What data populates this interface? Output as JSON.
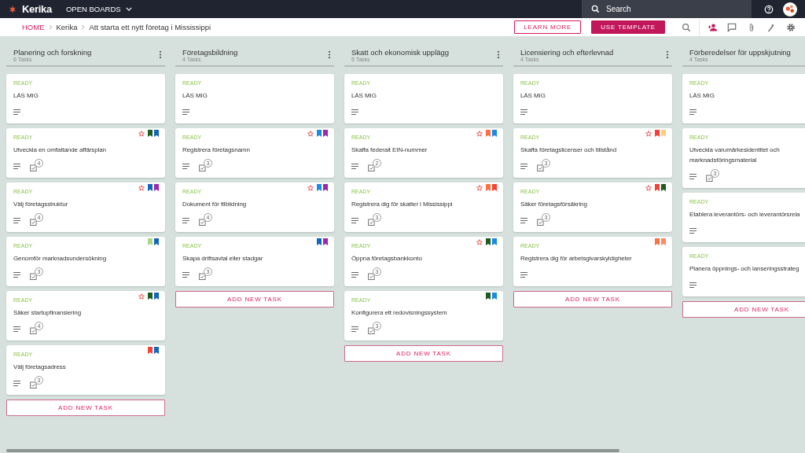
{
  "topbar": {
    "logo": "Kerika",
    "menu": "OPEN BOARDS",
    "search": {
      "placeholder": "Search"
    }
  },
  "breadcrumb": [
    "HOME",
    "Kerika",
    "Att starta ett nytt företag i Mississippi"
  ],
  "actions": [
    "LEARN MORE",
    "USE TEMPLATE"
  ],
  "columns": [
    {
      "title": "Planering och forskning",
      "count": "6 Tasks",
      "add": "ADD NEW TASK",
      "cards": [
        {
          "status": "READY",
          "title": "LÄS MIG",
          "starred": false
        },
        {
          "status": "READY",
          "title": "Utveckla en omfattande affärsplan",
          "starred": true,
          "tags": [
            {
              "color": "#1b5e20"
            },
            {
              "color": "#1565c0"
            }
          ],
          "checklist": "4"
        },
        {
          "status": "READY",
          "title": "Välj företagsstruktur",
          "starred": true,
          "tags": [
            {
              "color": "#1565c0"
            },
            {
              "color": "#9c27b0"
            }
          ],
          "checklist": "4"
        },
        {
          "status": "READY",
          "title": "Genomför marknadsundersökning",
          "starred": false,
          "tags": [
            {
              "color": "#aed581"
            },
            {
              "color": "#1565c0"
            }
          ],
          "checklist": "3"
        },
        {
          "status": "READY",
          "title": "Säker startupfinansiering",
          "starred": true,
          "tags": [
            {
              "color": "#1b5e20"
            },
            {
              "color": "#1565c0"
            }
          ],
          "checklist": "4"
        },
        {
          "status": "READY",
          "title": "Välj företagsadress",
          "starred": false,
          "tags": [
            {
              "color": "#f44336"
            },
            {
              "color": "#1565c0"
            }
          ],
          "checklist": "3"
        }
      ]
    },
    {
      "title": "Företagsbildning",
      "count": "4 Tasks",
      "add": "ADD NEW TASK",
      "cards": [
        {
          "status": "READY",
          "title": "LÄS MIG",
          "starred": false
        },
        {
          "status": "READY",
          "title": "Registrera företagsnamn",
          "starred": true,
          "tags": [
            {
              "color": "#1e88e5"
            },
            {
              "color": "#9c27b0"
            }
          ],
          "checklist": "3"
        },
        {
          "status": "READY",
          "title": "Dokument för filbildning",
          "starred": true,
          "tags": [
            {
              "color": "#1e88e5"
            },
            {
              "color": "#9c27b0"
            }
          ],
          "checklist": "4"
        },
        {
          "status": "READY",
          "title": "Skapa driftsavtal eller stadgar",
          "starred": false,
          "tags": [
            {
              "color": "#1565c0"
            },
            {
              "color": "#9c27b0"
            }
          ],
          "checklist": "3"
        }
      ]
    },
    {
      "title": "Skatt och ekonomisk upplägg",
      "count": "5 Tasks",
      "add": "ADD NEW TASK",
      "cards": [
        {
          "status": "READY",
          "title": "LÄS MIG",
          "starred": false
        },
        {
          "status": "READY",
          "title": "Skaffa federalt EIN-nummer",
          "starred": true,
          "tags": [
            {
              "color": "#ff7043"
            },
            {
              "color": "#1e88e5"
            }
          ],
          "checklist": "2"
        },
        {
          "status": "READY",
          "title": "Registrera dig för skatter i Mississippi",
          "starred": true,
          "tags": [
            {
              "color": "#ff7043"
            },
            {
              "color": "#f44336"
            }
          ],
          "checklist": "3"
        },
        {
          "status": "READY",
          "title": "Öppna företagsbankkonto",
          "starred": true,
          "tags": [
            {
              "color": "#1b5e20"
            },
            {
              "color": "#1e88e5"
            }
          ],
          "checklist": "3"
        },
        {
          "status": "READY",
          "title": "Konfigurera ett redovisningssystem",
          "starred": false,
          "tags": [
            {
              "color": "#1b5e20"
            },
            {
              "color": "#1e88e5"
            }
          ],
          "checklist": "3"
        }
      ]
    },
    {
      "title": "Licensiering och efterlevnad",
      "count": "4 Tasks",
      "add": "ADD NEW TASK",
      "cards": [
        {
          "status": "READY",
          "title": "LÄS MIG",
          "starred": false
        },
        {
          "status": "READY",
          "title": "Skaffa företagslicenser och tillstånd",
          "starred": true,
          "tags": [
            {
              "color": "#f44336"
            },
            {
              "color": "#ffcc80"
            }
          ],
          "checklist": "3"
        },
        {
          "status": "READY",
          "title": "Säker företagsförsäkring",
          "starred": true,
          "tags": [
            {
              "color": "#f44336"
            },
            {
              "color": "#1b5e20"
            }
          ],
          "checklist": "3"
        },
        {
          "status": "READY",
          "title": "Registrera dig för arbetsgivarskyldigheter",
          "starred": false,
          "tags": [
            {
              "color": "#ff7043"
            },
            {
              "color": "#ff8a65"
            }
          ]
        }
      ]
    },
    {
      "title": "Förberedelser för uppskjutning",
      "count": "4 Tasks",
      "add": "ADD NEW TASK",
      "cards": [
        {
          "status": "READY",
          "title": "LÄS MIG",
          "starred": false
        },
        {
          "status": "READY",
          "title": "Utveckla varumärkesidentitet och marknadsföringsmaterial",
          "starred": false,
          "checklist": "3"
        },
        {
          "status": "READY",
          "title": "Etablera leverantörs- och leverantörsrela",
          "starred": false
        },
        {
          "status": "READY",
          "title": "Planera öppnings- och lanseringsstrateg",
          "starred": false
        }
      ]
    }
  ]
}
